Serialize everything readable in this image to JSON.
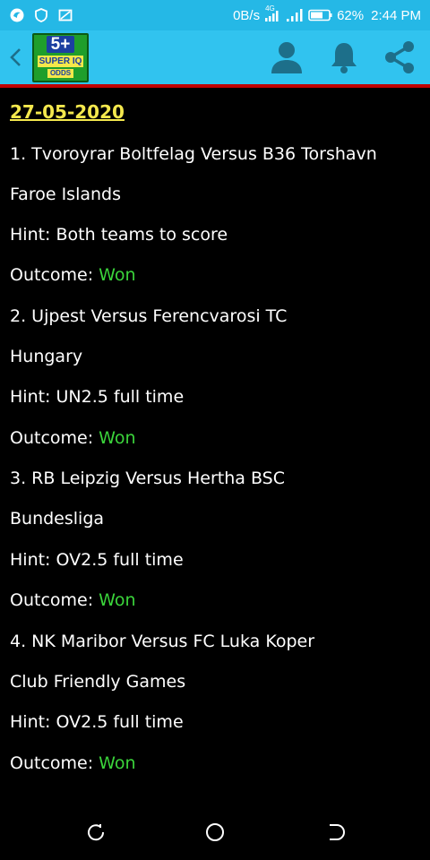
{
  "status_bar": {
    "network_speed": "0B/s",
    "network_type": "4G",
    "battery": "62%",
    "time": "2:44 PM"
  },
  "app_bar": {
    "logo": {
      "line1": "5+",
      "line2": "SUPER IQ",
      "line3": "ODDS"
    },
    "icons": [
      "back-icon",
      "person-icon",
      "bell-icon",
      "share-icon"
    ]
  },
  "date": "27-05-2020",
  "matches": [
    {
      "title": "1. Tvoroyrar Boltfelag Versus B36 Torshavn",
      "league": "Faroe Islands",
      "hint": "Hint: Both teams to score",
      "outcome_label": "Outcome: ",
      "outcome": "Won"
    },
    {
      "title": "2. Ujpest Versus Ferencvarosi TC",
      "league": "Hungary",
      "hint": "Hint: UN2.5 full time",
      "outcome_label": "Outcome: ",
      "outcome": "Won"
    },
    {
      "title": "3. RB Leipzig Versus Hertha BSC",
      "league": "Bundesliga",
      "hint": "Hint: OV2.5 full time",
      "outcome_label": "Outcome: ",
      "outcome": "Won"
    },
    {
      "title": "4. NK Maribor Versus FC Luka Koper",
      "league": "Club Friendly Games",
      "hint": "Hint: OV2.5 full time",
      "outcome_label": "Outcome: ",
      "outcome": "Won"
    }
  ],
  "colors": {
    "status_bar": "#25b8e6",
    "app_bar": "#31c3ef",
    "divider": "#c00000",
    "date": "#f4e84d",
    "won": "#3bd43b",
    "background": "#000000"
  }
}
